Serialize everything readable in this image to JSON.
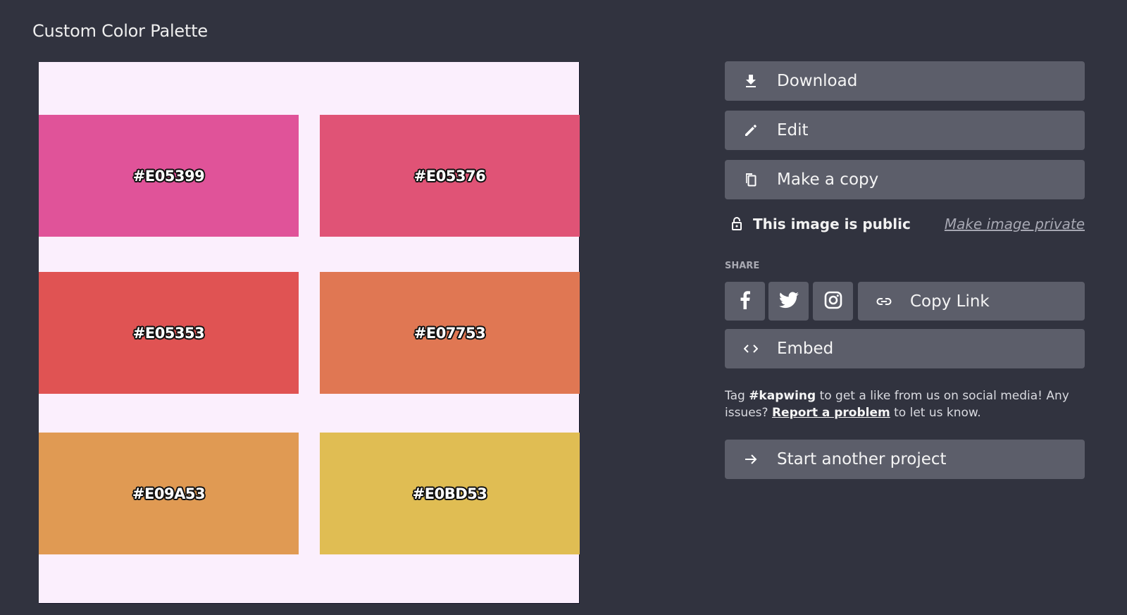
{
  "page": {
    "title": "Custom Color Palette"
  },
  "palette": {
    "background": "#FBEFFD",
    "swatches": [
      {
        "label": "#E05399",
        "color": "#E05399"
      },
      {
        "label": "#E05376",
        "color": "#E05376"
      },
      {
        "label": "#E05353",
        "color": "#E05353"
      },
      {
        "label": "#E07753",
        "color": "#E07753"
      },
      {
        "label": "#E09A53",
        "color": "#E09A53"
      },
      {
        "label": "#E0BD53",
        "color": "#E0BD53"
      }
    ]
  },
  "actions": {
    "download": {
      "label": "Download",
      "icon": "download-icon"
    },
    "edit": {
      "label": "Edit",
      "icon": "pencil-icon"
    },
    "copy": {
      "label": "Make a copy",
      "icon": "copy-icon"
    }
  },
  "privacy": {
    "status": "This image is public",
    "toggle_link": "Make image private",
    "icon": "lock-open-icon"
  },
  "share": {
    "label": "SHARE",
    "networks": [
      {
        "name": "facebook",
        "icon": "facebook-icon"
      },
      {
        "name": "twitter",
        "icon": "twitter-icon"
      },
      {
        "name": "instagram",
        "icon": "instagram-icon"
      }
    ],
    "copy_link": {
      "label": "Copy Link",
      "icon": "link-icon"
    },
    "embed": {
      "label": "Embed",
      "icon": "code-icon"
    }
  },
  "footer_note": {
    "prefix": "Tag ",
    "hashtag": "#kapwing",
    "middle": " to get a like from us on social media! Any issues? ",
    "link": "Report a problem",
    "suffix": " to let us know."
  },
  "start_project": {
    "label": "Start another project",
    "icon": "arrow-right-icon"
  }
}
